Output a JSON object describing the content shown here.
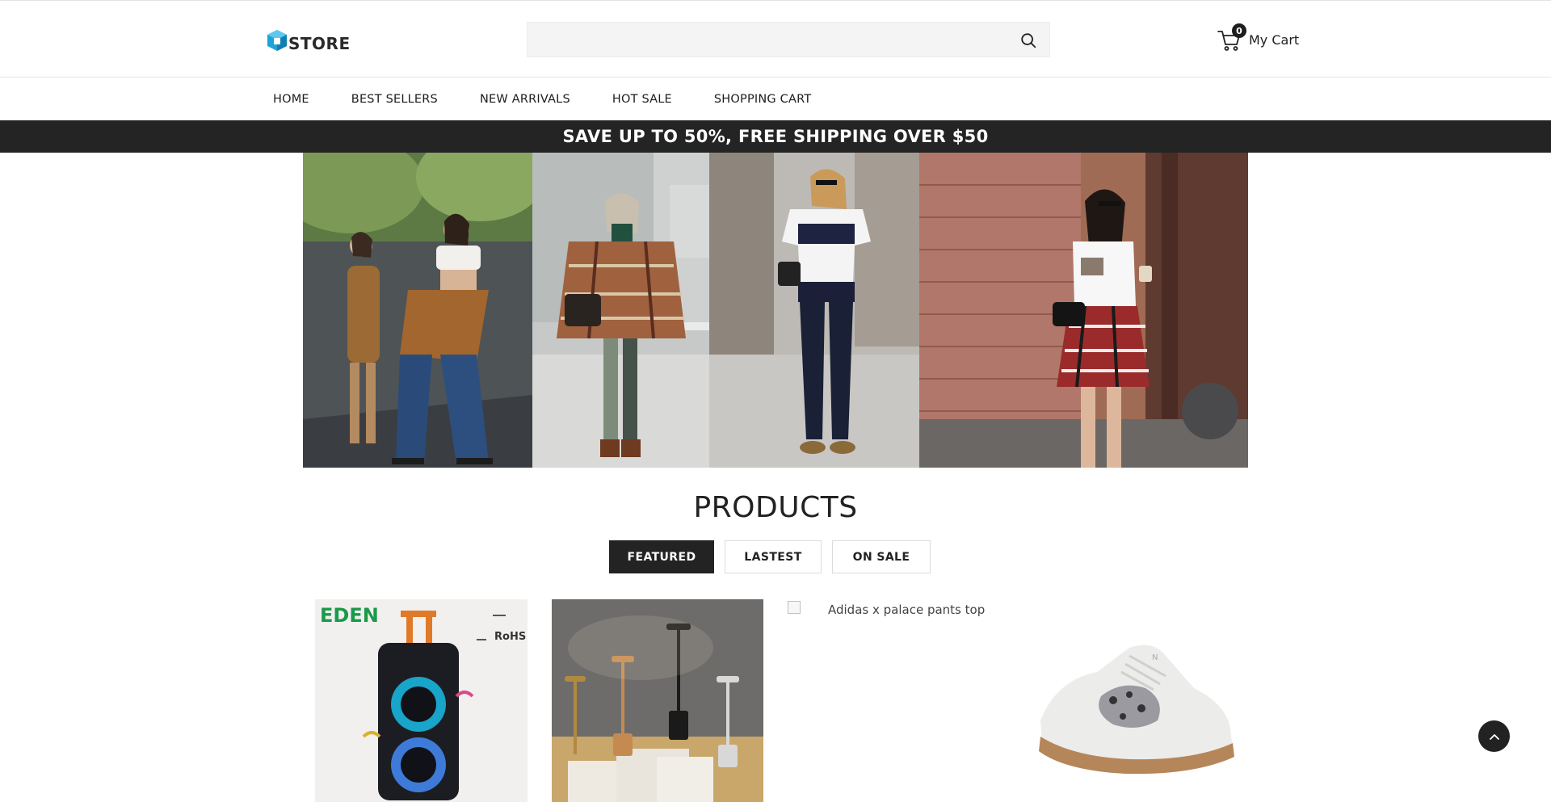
{
  "header": {
    "logo_text": "STORE",
    "search": {
      "value": "",
      "placeholder": ""
    },
    "cart": {
      "count": "0",
      "label": "My Cart"
    }
  },
  "nav": {
    "items": [
      {
        "label": "HOME"
      },
      {
        "label": "BEST SELLERS"
      },
      {
        "label": "NEW ARRIVALS"
      },
      {
        "label": "HOT SALE"
      },
      {
        "label": "SHOPPING CART"
      }
    ]
  },
  "promo": {
    "text": "SAVE UP TO 50%, FREE SHIPPING OVER $50"
  },
  "products_section": {
    "title": "PRODUCTS",
    "tabs": [
      {
        "label": "FEATURED",
        "active": true
      },
      {
        "label": "LASTEST",
        "active": false
      },
      {
        "label": "ON SALE",
        "active": false
      }
    ],
    "items": [
      {
        "image": "party-speaker",
        "brand_text": "EDEN",
        "cert_text": "RoHS"
      },
      {
        "image": "table-lamps"
      },
      {
        "image": "broken-image",
        "alt": "Adidas x palace pants top"
      },
      {
        "image": "sneaker"
      }
    ]
  },
  "colors": {
    "promo_bg": "#242424",
    "accent_logo": "#1fa3d6",
    "text": "#222222"
  }
}
